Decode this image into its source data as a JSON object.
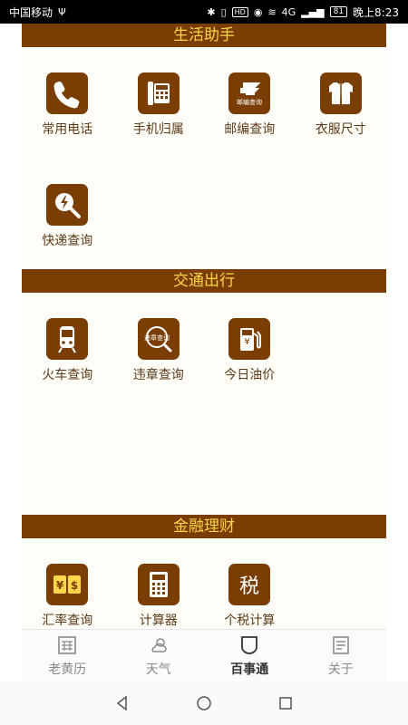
{
  "status_bar": {
    "carrier": "中国移动",
    "usb": "Ψ",
    "network": "4G",
    "battery": "81",
    "time": "晚上8:23"
  },
  "sections": [
    {
      "title": "生活助手",
      "items": [
        {
          "label": "常用电话",
          "icon": "phone-icon"
        },
        {
          "label": "手机归属",
          "icon": "desk-phone-icon"
        },
        {
          "label": "邮编查询",
          "icon": "postal-icon",
          "icon_text": "邮编查询"
        },
        {
          "label": "衣服尺寸",
          "icon": "clothes-icon"
        },
        {
          "label": "快递查询",
          "icon": "express-search-icon"
        }
      ]
    },
    {
      "title": "交通出行",
      "items": [
        {
          "label": "火车查询",
          "icon": "train-icon"
        },
        {
          "label": "违章查询",
          "icon": "violation-search-icon",
          "icon_text": "违章查询"
        },
        {
          "label": "今日油价",
          "icon": "fuel-pump-icon",
          "icon_text": "¥"
        }
      ]
    },
    {
      "title": "金融理财",
      "items": [
        {
          "label": "汇率查询",
          "icon": "exchange-rate-icon",
          "icon_text_left": "¥",
          "icon_text_right": "$"
        },
        {
          "label": "计算器",
          "icon": "calculator-icon"
        },
        {
          "label": "个税计算",
          "icon": "tax-icon",
          "icon_text": "税"
        }
      ]
    }
  ],
  "bottom_nav": [
    {
      "label": "老黄历",
      "icon": "almanac-icon",
      "active": false
    },
    {
      "label": "天气",
      "icon": "weather-icon",
      "active": false
    },
    {
      "label": "百事通",
      "icon": "shield-icon",
      "active": true
    },
    {
      "label": "关于",
      "icon": "about-icon",
      "active": false
    }
  ],
  "colors": {
    "header_bg": "#7a3d04",
    "header_text": "#ffd54a",
    "label_text": "#5b3a17",
    "content_bg": "#fffdf7"
  }
}
